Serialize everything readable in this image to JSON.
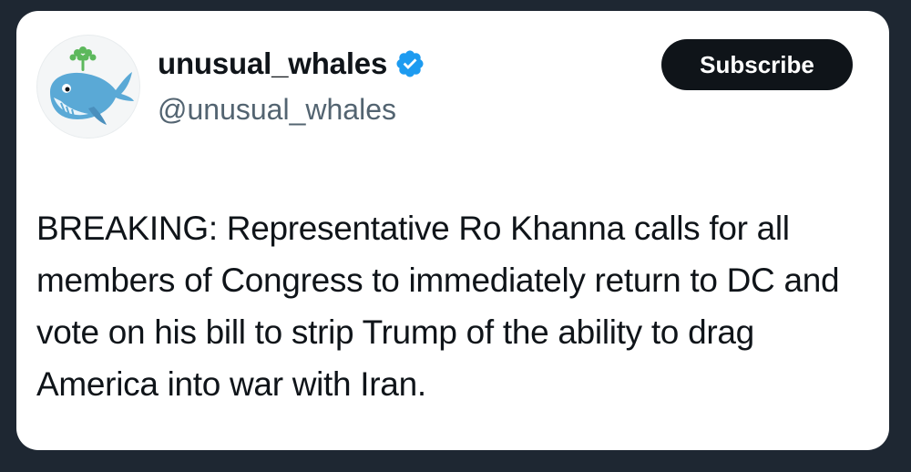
{
  "profile": {
    "display_name": "unusual_whales",
    "handle": "@unusual_whales",
    "avatar_icon": "whale-logo-icon",
    "verified_icon": "verified-badge-icon",
    "verified_color": "#1d9bf0"
  },
  "actions": {
    "subscribe_label": "Subscribe"
  },
  "tweet": {
    "text": "BREAKING: Representative Ro Khanna calls for all members of Congress to immediately return to DC and vote on his bill to strip Trump of the ability to drag America into war with Iran."
  },
  "colors": {
    "background": "#1e2732",
    "card": "#ffffff",
    "text_primary": "#0f1419",
    "text_secondary": "#536471",
    "button_bg": "#0f1419",
    "button_text": "#ffffff"
  }
}
